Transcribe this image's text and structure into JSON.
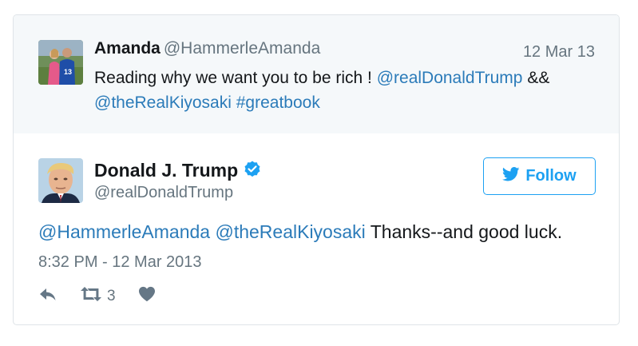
{
  "parent_tweet": {
    "author_name": "Amanda",
    "author_handle": "@HammerleAmanda",
    "date": "12 Mar 13",
    "text_before": "Reading why we want you to be rich ! ",
    "mention_1": "@realDonaldTrump",
    "text_mid": " &&",
    "mention_2": "@theRealKiyosaki",
    "hashtag": " #greatbook"
  },
  "main_tweet": {
    "author_name": "Donald J. Trump",
    "author_handle": "@realDonaldTrump",
    "verified_icon": "verified-badge-icon",
    "follow_label": "Follow",
    "mention_1": "@HammerleAmanda",
    "mention_2": " @theRealKiyosaki",
    "text": " Thanks--and good luck.",
    "timestamp": "8:32 PM - 12 Mar 2013",
    "retweet_count": "3"
  },
  "colors": {
    "link": "#2b7bb9",
    "accent": "#1da1f2",
    "parent_bg": "#f5f8fa",
    "muted": "#66757f"
  }
}
